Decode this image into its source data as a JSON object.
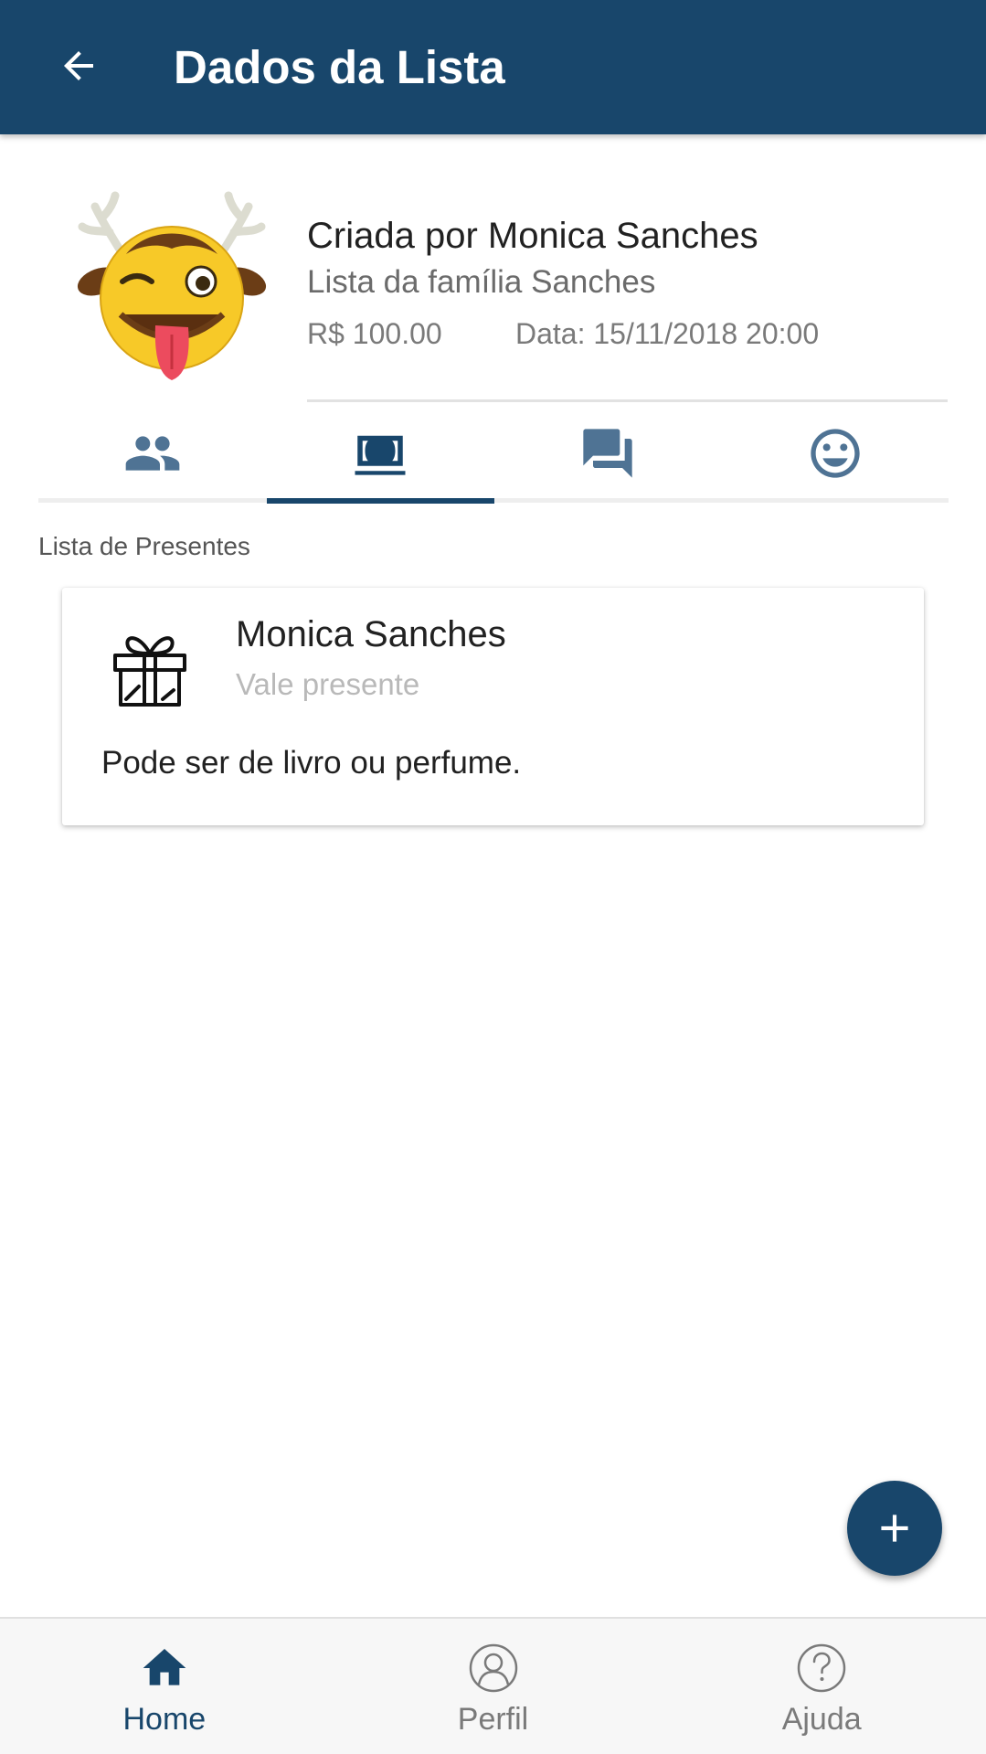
{
  "appbar": {
    "title": "Dados da Lista",
    "back_icon": "arrow-back-icon",
    "color": "#18466b"
  },
  "header": {
    "avatar_icon": "reindeer-emoji-avatar",
    "creator": "Criada por Monica Sanches",
    "list_name": "Lista da família Sanches",
    "price": "R$ 100.00",
    "date": "Data: 15/11/2018 20:00"
  },
  "tabs": [
    {
      "icon": "group-icon",
      "selected": false
    },
    {
      "icon": "money-icon",
      "selected": true
    },
    {
      "icon": "chat-icon",
      "selected": false
    },
    {
      "icon": "smiley-icon",
      "selected": false
    }
  ],
  "section": {
    "label": "Lista de Presentes"
  },
  "gifts": [
    {
      "icon": "gift-icon",
      "name": "Monica Sanches",
      "type": "Vale presente",
      "description": "Pode ser de livro ou perfume."
    }
  ],
  "fab": {
    "icon": "add-icon"
  },
  "bottom_nav": [
    {
      "label": "Home",
      "icon": "home-icon",
      "active": true
    },
    {
      "label": "Perfil",
      "icon": "profile-icon",
      "active": false
    },
    {
      "label": "Ajuda",
      "icon": "help-icon",
      "active": false
    }
  ],
  "colors": {
    "primary": "#18466b",
    "tab_icon_inactive": "#4f7394",
    "muted_text": "#7a7a7a"
  }
}
